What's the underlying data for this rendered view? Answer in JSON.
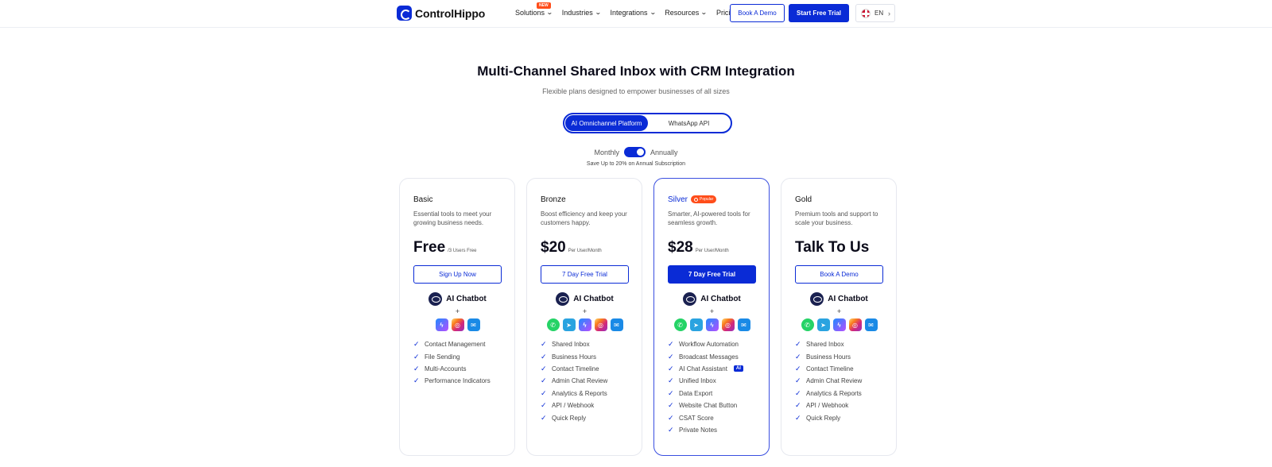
{
  "header": {
    "brand": "ControlHippo",
    "nav": [
      {
        "label": "Solutions",
        "badge": "NEW"
      },
      {
        "label": "Industries"
      },
      {
        "label": "Integrations"
      },
      {
        "label": "Resources"
      },
      {
        "label": "Pricing"
      }
    ],
    "book_demo": "Book A Demo",
    "start_trial": "Start Free Trial",
    "language": "EN"
  },
  "hero": {
    "title": "Multi-Channel Shared Inbox with CRM Integration",
    "subtitle": "Flexible plans designed to empower businesses of all sizes",
    "tabs": [
      "AI Omnichannel Platform",
      "WhatsApp API"
    ],
    "billing_monthly": "Monthly",
    "billing_annually": "Annually",
    "billing_state": "Annually",
    "save_note": "Save Up to 20% on Annual Subscription"
  },
  "accent_color": "#0a2bd6",
  "plans": [
    {
      "name": "Basic",
      "desc": "Essential tools to meet your growing business needs.",
      "price": "Free",
      "unit": "/3 Users Free",
      "cta": "Sign Up Now",
      "chatbot": "AI Chatbot",
      "plus": "+",
      "channels": [
        "messenger-icon",
        "instagram-icon",
        "email-icon"
      ],
      "features": [
        "Contact Management",
        "File Sending",
        "Multi-Accounts",
        "Performance Indicators"
      ]
    },
    {
      "name": "Bronze",
      "desc": "Boost efficiency and keep your customers happy.",
      "price": "$20",
      "unit": "Per User/Month",
      "cta": "7 Day Free Trial",
      "chatbot": "AI Chatbot",
      "plus": "+",
      "channels": [
        "whatsapp-icon",
        "telegram-icon",
        "messenger-icon",
        "instagram-icon",
        "email-icon"
      ],
      "features": [
        "Shared Inbox",
        "Business Hours",
        "Contact Timeline",
        "Admin Chat Review",
        "Analytics & Reports",
        "API / Webhook",
        "Quick Reply"
      ]
    },
    {
      "name": "Silver",
      "badge": "Popular",
      "desc": "Smarter, AI-powered tools for seamless growth.",
      "price": "$28",
      "unit": "Per User/Month",
      "cta": "7 Day Free Trial",
      "chatbot": "AI Chatbot",
      "plus": "+",
      "channels": [
        "whatsapp-icon",
        "telegram-icon",
        "messenger-icon",
        "instagram-icon",
        "email-icon"
      ],
      "features": [
        "Workflow Automation",
        "Broadcast Messages",
        "AI Chat Assistant",
        "Unified Inbox",
        "Data Export",
        "Website Chat Button",
        "CSAT Score",
        "Private Notes"
      ],
      "ai_badge": "AI"
    },
    {
      "name": "Gold",
      "desc": "Premium tools and support to scale your business.",
      "price": "Talk To Us",
      "unit": "",
      "cta": "Book A Demo",
      "chatbot": "AI Chatbot",
      "plus": "+",
      "channels": [
        "whatsapp-icon",
        "telegram-icon",
        "messenger-icon",
        "instagram-icon",
        "email-icon"
      ],
      "features": [
        "Shared Inbox",
        "Business Hours",
        "Contact Timeline",
        "Admin Chat Review",
        "Analytics & Reports",
        "API / Webhook",
        "Quick Reply"
      ]
    }
  ]
}
